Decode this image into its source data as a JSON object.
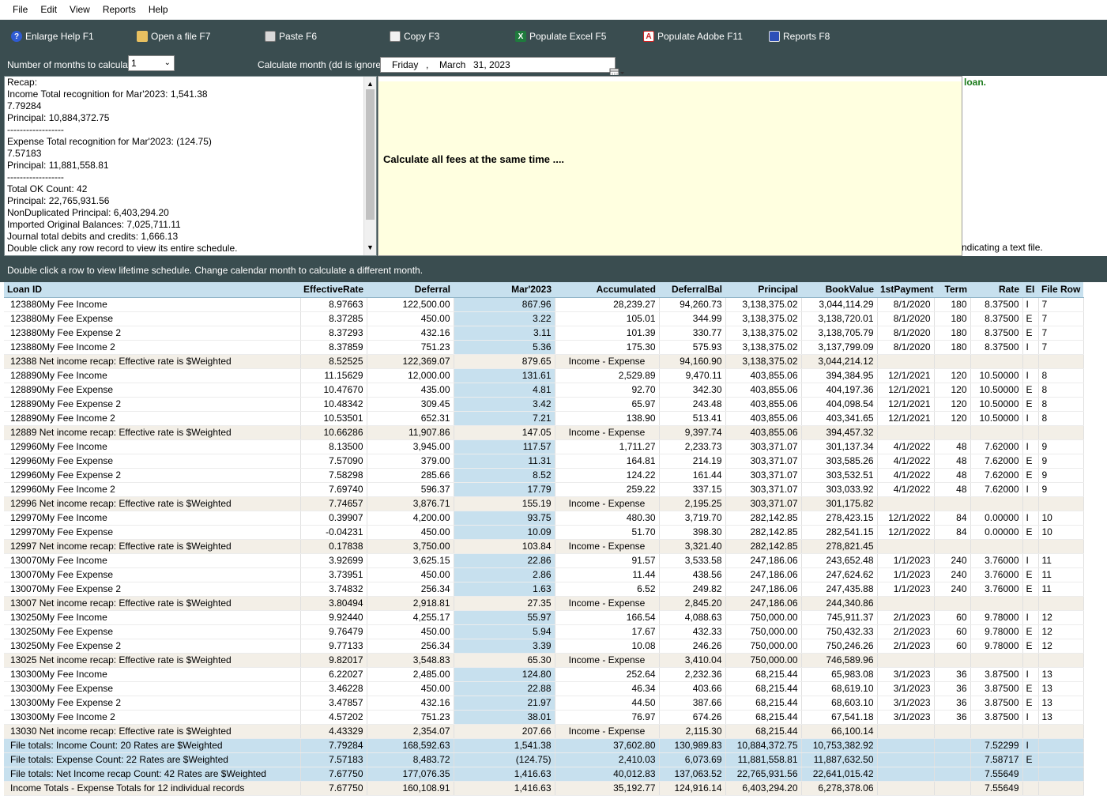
{
  "menu": [
    "File",
    "Edit",
    "View",
    "Reports",
    "Help"
  ],
  "toolbar": {
    "enlarge_help": "Enlarge Help  F1",
    "open_file": "Open a file  F7",
    "paste": "Paste  F6",
    "copy": "Copy  F3",
    "populate_excel": "Populate Excel  F5",
    "populate_adobe": "Populate Adobe  F11",
    "reports": "Reports  F8"
  },
  "controls": {
    "months_label": "Number of months to calculate:",
    "months_value": "1",
    "calc_month_label": "Calculate month (dd is ignored)",
    "date_day": "Friday",
    "date_comma": ",",
    "date_month": "March",
    "date_date": "31, 2023"
  },
  "recap_lines": [
    "Recap:",
    "Income Total recognition for Mar'2023: 1,541.38",
    "7.79284",
    "Principal: 10,884,372.75",
    "------------------",
    "Expense Total recognition for Mar'2023: (124.75)",
    "7.57183",
    "Principal: 11,881,558.81",
    "------------------",
    "Total OK Count: 42",
    "Principal: 22,765,931.56",
    "NonDuplicated Principal: 6,403,294.20",
    "Imported Original Balances: 7,025,711.11",
    "Journal total debits and credits: 1,666.13",
    "Double click any row record to view its entire schedule."
  ],
  "help": {
    "message": "Calculate all fees at the same time ....",
    "right_loan": "loan.",
    "right_textfile": "ndicating a text file."
  },
  "status_text": "Double click a row to view lifetime schedule.  Change calendar month to calculate a different month.",
  "grid": {
    "columns": [
      "Loan ID",
      "EffectiveRate",
      "Deferral",
      "Mar'2023",
      "Accumulated",
      "DeferralBal",
      "Principal",
      "BookValue",
      "1stPayment",
      "Term",
      "Rate",
      "EI",
      "File Row"
    ],
    "rows": [
      {
        "t": "d",
        "c": [
          "123880My Fee Income",
          "8.97663",
          "122,500.00",
          "867.96",
          "28,239.27",
          "94,260.73",
          "3,138,375.02",
          "3,044,114.29",
          "8/1/2020",
          "180",
          "8.37500",
          "I",
          "7"
        ]
      },
      {
        "t": "d",
        "c": [
          "123880My Fee Expense",
          "8.37285",
          "450.00",
          "3.22",
          "105.01",
          "344.99",
          "3,138,375.02",
          "3,138,720.01",
          "8/1/2020",
          "180",
          "8.37500",
          "E",
          "7"
        ]
      },
      {
        "t": "d",
        "c": [
          "123880My Fee Expense 2",
          "8.37293",
          "432.16",
          "3.11",
          "101.39",
          "330.77",
          "3,138,375.02",
          "3,138,705.79",
          "8/1/2020",
          "180",
          "8.37500",
          "E",
          "7"
        ]
      },
      {
        "t": "d",
        "c": [
          "123880My Fee Income 2",
          "8.37859",
          "751.23",
          "5.36",
          "175.30",
          "575.93",
          "3,138,375.02",
          "3,137,799.09",
          "8/1/2020",
          "180",
          "8.37500",
          "I",
          "7"
        ]
      },
      {
        "t": "n",
        "c": [
          "12388 Net income recap: Effective rate is $Weighted",
          "8.52525",
          "122,369.07",
          "879.65",
          "Income - Expense",
          "94,160.90",
          "3,138,375.02",
          "3,044,214.12",
          "",
          "",
          "",
          "",
          ""
        ]
      },
      {
        "t": "d",
        "c": [
          "128890My Fee Income",
          "11.15629",
          "12,000.00",
          "131.61",
          "2,529.89",
          "9,470.11",
          "403,855.06",
          "394,384.95",
          "12/1/2021",
          "120",
          "10.50000",
          "I",
          "8"
        ]
      },
      {
        "t": "d",
        "c": [
          "128890My Fee Expense",
          "10.47670",
          "435.00",
          "4.81",
          "92.70",
          "342.30",
          "403,855.06",
          "404,197.36",
          "12/1/2021",
          "120",
          "10.50000",
          "E",
          "8"
        ]
      },
      {
        "t": "d",
        "c": [
          "128890My Fee Expense 2",
          "10.48342",
          "309.45",
          "3.42",
          "65.97",
          "243.48",
          "403,855.06",
          "404,098.54",
          "12/1/2021",
          "120",
          "10.50000",
          "E",
          "8"
        ]
      },
      {
        "t": "d",
        "c": [
          "128890My Fee Income 2",
          "10.53501",
          "652.31",
          "7.21",
          "138.90",
          "513.41",
          "403,855.06",
          "403,341.65",
          "12/1/2021",
          "120",
          "10.50000",
          "I",
          "8"
        ]
      },
      {
        "t": "n",
        "c": [
          "12889 Net income recap: Effective rate is $Weighted",
          "10.66286",
          "11,907.86",
          "147.05",
          "Income - Expense",
          "9,397.74",
          "403,855.06",
          "394,457.32",
          "",
          "",
          "",
          "",
          ""
        ]
      },
      {
        "t": "d",
        "c": [
          "129960My Fee Income",
          "8.13500",
          "3,945.00",
          "117.57",
          "1,711.27",
          "2,233.73",
          "303,371.07",
          "301,137.34",
          "4/1/2022",
          "48",
          "7.62000",
          "I",
          "9"
        ]
      },
      {
        "t": "d",
        "c": [
          "129960My Fee Expense",
          "7.57090",
          "379.00",
          "11.31",
          "164.81",
          "214.19",
          "303,371.07",
          "303,585.26",
          "4/1/2022",
          "48",
          "7.62000",
          "E",
          "9"
        ]
      },
      {
        "t": "d",
        "c": [
          "129960My Fee Expense 2",
          "7.58298",
          "285.66",
          "8.52",
          "124.22",
          "161.44",
          "303,371.07",
          "303,532.51",
          "4/1/2022",
          "48",
          "7.62000",
          "E",
          "9"
        ]
      },
      {
        "t": "d",
        "c": [
          "129960My Fee Income 2",
          "7.69740",
          "596.37",
          "17.79",
          "259.22",
          "337.15",
          "303,371.07",
          "303,033.92",
          "4/1/2022",
          "48",
          "7.62000",
          "I",
          "9"
        ]
      },
      {
        "t": "n",
        "c": [
          "12996 Net income recap: Effective rate is $Weighted",
          "7.74657",
          "3,876.71",
          "155.19",
          "Income - Expense",
          "2,195.25",
          "303,371.07",
          "301,175.82",
          "",
          "",
          "",
          "",
          ""
        ]
      },
      {
        "t": "d",
        "c": [
          "129970My Fee Income",
          "0.39907",
          "4,200.00",
          "93.75",
          "480.30",
          "3,719.70",
          "282,142.85",
          "278,423.15",
          "12/1/2022",
          "84",
          "0.00000",
          "I",
          "10"
        ]
      },
      {
        "t": "d",
        "c": [
          "129970My Fee Expense",
          "-0.04231",
          "450.00",
          "10.09",
          "51.70",
          "398.30",
          "282,142.85",
          "282,541.15",
          "12/1/2022",
          "84",
          "0.00000",
          "E",
          "10"
        ]
      },
      {
        "t": "n",
        "c": [
          "12997 Net income recap: Effective rate is $Weighted",
          "0.17838",
          "3,750.00",
          "103.84",
          "Income - Expense",
          "3,321.40",
          "282,142.85",
          "278,821.45",
          "",
          "",
          "",
          "",
          ""
        ]
      },
      {
        "t": "d",
        "c": [
          "130070My Fee Income",
          "3.92699",
          "3,625.15",
          "22.86",
          "91.57",
          "3,533.58",
          "247,186.06",
          "243,652.48",
          "1/1/2023",
          "240",
          "3.76000",
          "I",
          "11"
        ]
      },
      {
        "t": "d",
        "c": [
          "130070My Fee Expense",
          "3.73951",
          "450.00",
          "2.86",
          "11.44",
          "438.56",
          "247,186.06",
          "247,624.62",
          "1/1/2023",
          "240",
          "3.76000",
          "E",
          "11"
        ]
      },
      {
        "t": "d",
        "c": [
          "130070My Fee Expense 2",
          "3.74832",
          "256.34",
          "1.63",
          "6.52",
          "249.82",
          "247,186.06",
          "247,435.88",
          "1/1/2023",
          "240",
          "3.76000",
          "E",
          "11"
        ]
      },
      {
        "t": "n",
        "c": [
          "13007 Net income recap: Effective rate is $Weighted",
          "3.80494",
          "2,918.81",
          "27.35",
          "Income - Expense",
          "2,845.20",
          "247,186.06",
          "244,340.86",
          "",
          "",
          "",
          "",
          ""
        ]
      },
      {
        "t": "d",
        "c": [
          "130250My Fee Income",
          "9.92440",
          "4,255.17",
          "55.97",
          "166.54",
          "4,088.63",
          "750,000.00",
          "745,911.37",
          "2/1/2023",
          "60",
          "9.78000",
          "I",
          "12"
        ]
      },
      {
        "t": "d",
        "c": [
          "130250My Fee Expense",
          "9.76479",
          "450.00",
          "5.94",
          "17.67",
          "432.33",
          "750,000.00",
          "750,432.33",
          "2/1/2023",
          "60",
          "9.78000",
          "E",
          "12"
        ]
      },
      {
        "t": "d",
        "c": [
          "130250My Fee Expense 2",
          "9.77133",
          "256.34",
          "3.39",
          "10.08",
          "246.26",
          "750,000.00",
          "750,246.26",
          "2/1/2023",
          "60",
          "9.78000",
          "E",
          "12"
        ]
      },
      {
        "t": "n",
        "c": [
          "13025 Net income recap: Effective rate is $Weighted",
          "9.82017",
          "3,548.83",
          "65.30",
          "Income - Expense",
          "3,410.04",
          "750,000.00",
          "746,589.96",
          "",
          "",
          "",
          "",
          ""
        ]
      },
      {
        "t": "d",
        "c": [
          "130300My Fee Income",
          "6.22027",
          "2,485.00",
          "124.80",
          "252.64",
          "2,232.36",
          "68,215.44",
          "65,983.08",
          "3/1/2023",
          "36",
          "3.87500",
          "I",
          "13"
        ]
      },
      {
        "t": "d",
        "c": [
          "130300My Fee Expense",
          "3.46228",
          "450.00",
          "22.88",
          "46.34",
          "403.66",
          "68,215.44",
          "68,619.10",
          "3/1/2023",
          "36",
          "3.87500",
          "E",
          "13"
        ]
      },
      {
        "t": "d",
        "c": [
          "130300My Fee Expense 2",
          "3.47857",
          "432.16",
          "21.97",
          "44.50",
          "387.66",
          "68,215.44",
          "68,603.10",
          "3/1/2023",
          "36",
          "3.87500",
          "E",
          "13"
        ]
      },
      {
        "t": "d",
        "c": [
          "130300My Fee Income 2",
          "4.57202",
          "751.23",
          "38.01",
          "76.97",
          "674.26",
          "68,215.44",
          "67,541.18",
          "3/1/2023",
          "36",
          "3.87500",
          "I",
          "13"
        ]
      },
      {
        "t": "n",
        "c": [
          "13030 Net income recap: Effective rate is $Weighted",
          "4.43329",
          "2,354.07",
          "207.66",
          "Income - Expense",
          "2,115.30",
          "68,215.44",
          "66,100.14",
          "",
          "",
          "",
          "",
          ""
        ]
      },
      {
        "t": "t",
        "c": [
          "File totals: Income   Count: 20   Rates are $Weighted",
          "7.79284",
          "168,592.63",
          "1,541.38",
          "37,602.80",
          "130,989.83",
          "10,884,372.75",
          "10,753,382.92",
          "",
          "",
          "7.52299",
          "I",
          ""
        ]
      },
      {
        "t": "t",
        "c": [
          "File totals: Expense   Count: 22   Rates are $Weighted",
          "7.57183",
          "8,483.72",
          "(124.75)",
          "2,410.03",
          "6,073.69",
          "11,881,558.81",
          "11,887,632.50",
          "",
          "",
          "7.58717",
          "E",
          ""
        ]
      },
      {
        "t": "t",
        "c": [
          "File totals: Net Income recap  Count: 42   Rates are $Weighted",
          "7.67750",
          "177,076.35",
          "1,416.63",
          "40,012.83",
          "137,063.52",
          "22,765,931.56",
          "22,641,015.42",
          "",
          "",
          "7.55649",
          "",
          ""
        ]
      },
      {
        "t": "t2",
        "c": [
          "Income Totals - Expense Totals for 12 individual records",
          "7.67750",
          "160,108.91",
          "1,416.63",
          "35,192.77",
          "124,916.14",
          "6,403,294.20",
          "6,278,378.06",
          "",
          "",
          "7.55649",
          "",
          ""
        ]
      }
    ]
  }
}
